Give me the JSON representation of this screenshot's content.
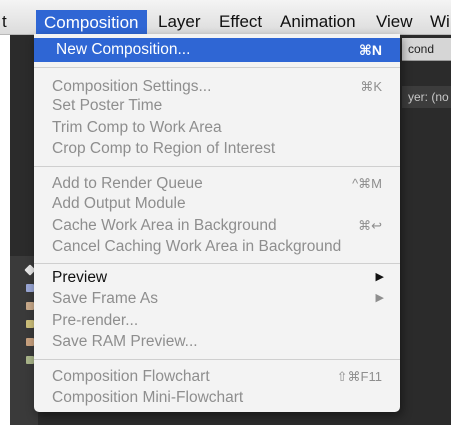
{
  "menubar": {
    "items": [
      {
        "label": "t"
      },
      {
        "label": "Composition"
      },
      {
        "label": "Layer"
      },
      {
        "label": "Effect"
      },
      {
        "label": "Animation"
      },
      {
        "label": "View"
      },
      {
        "label": "Wi"
      }
    ]
  },
  "panels": {
    "top_right": "cond",
    "layer_label": "yer: (no"
  },
  "menu": {
    "items": [
      {
        "label": "New Composition...",
        "shortcut": "⌘N"
      },
      {
        "label": "Composition Settings...",
        "shortcut": "⌘K"
      },
      {
        "label": "Set Poster Time",
        "shortcut": ""
      },
      {
        "label": "Trim Comp to Work Area",
        "shortcut": ""
      },
      {
        "label": "Crop Comp to Region of Interest",
        "shortcut": ""
      },
      {
        "label": "Add to Render Queue",
        "shortcut": "^⌘M"
      },
      {
        "label": "Add Output Module",
        "shortcut": ""
      },
      {
        "label": "Cache Work Area in Background",
        "shortcut": "⌘↩"
      },
      {
        "label": "Cancel Caching Work Area in Background",
        "shortcut": ""
      },
      {
        "label": "Preview",
        "shortcut": "▶"
      },
      {
        "label": "Save Frame As",
        "shortcut": "▶"
      },
      {
        "label": "Pre-render...",
        "shortcut": ""
      },
      {
        "label": "Save RAM Preview...",
        "shortcut": ""
      },
      {
        "label": "Composition Flowchart",
        "shortcut": "⇧⌘F11"
      },
      {
        "label": "Composition Mini-Flowchart",
        "shortcut": ""
      }
    ]
  },
  "colors": {
    "highlight": "#2f66d4",
    "menu_bg": "#f3f3f3",
    "disabled_text": "#8e8e8e",
    "app_bg": "#2b2b2b"
  }
}
